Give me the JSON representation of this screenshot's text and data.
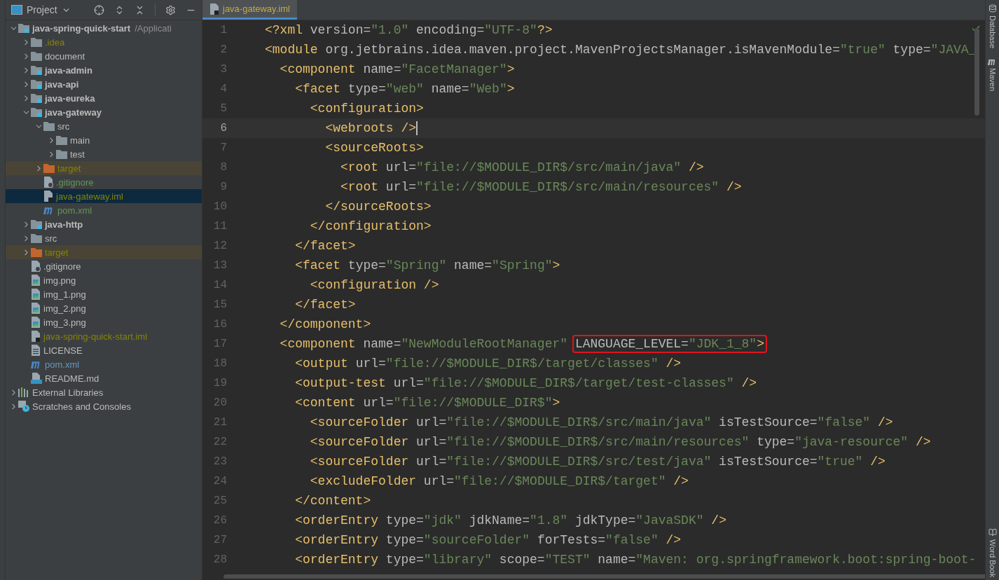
{
  "project_panel": {
    "title": "Project",
    "tree": [
      {
        "name": "java-spring-quick-start",
        "path": "/Applicati",
        "kind": "module",
        "color": "#bbbbbb",
        "expanded": true,
        "selected": false,
        "children": [
          {
            "name": ".idea",
            "kind": "folder",
            "color": "#848504",
            "expanded": false,
            "selected": false
          },
          {
            "name": "document",
            "kind": "folder",
            "color": "#bbbbbb",
            "expanded": false,
            "selected": false
          },
          {
            "name": "java-admin",
            "kind": "module",
            "color": "#bbbbbb",
            "expanded": false,
            "selected": false
          },
          {
            "name": "java-api",
            "kind": "module",
            "color": "#bbbbbb",
            "expanded": false,
            "selected": false
          },
          {
            "name": "java-eureka",
            "kind": "module",
            "color": "#bbbbbb",
            "expanded": false,
            "selected": false
          },
          {
            "name": "java-gateway",
            "kind": "module",
            "color": "#bbbbbb",
            "expanded": true,
            "selected": false,
            "children": [
              {
                "name": "src",
                "kind": "folder",
                "color": "#bbbbbb",
                "expanded": true,
                "selected": false,
                "children": [
                  {
                    "name": "main",
                    "kind": "folder",
                    "color": "#bbbbbb",
                    "expanded": false,
                    "selected": false
                  },
                  {
                    "name": "test",
                    "kind": "folder",
                    "color": "#bbbbbb",
                    "expanded": false,
                    "selected": false
                  }
                ]
              },
              {
                "name": "target",
                "kind": "excluded",
                "color": "#848504",
                "expanded": false,
                "selected": false
              },
              {
                "name": ".gitignore",
                "kind": "ignore-file",
                "color": "#629755",
                "selected": false
              },
              {
                "name": "java-gateway.iml",
                "kind": "iml",
                "color": "#848504",
                "selected": true
              },
              {
                "name": "pom.xml",
                "kind": "maven",
                "color": "#629755",
                "selected": false
              }
            ]
          },
          {
            "name": "java-http",
            "kind": "module",
            "color": "#bbbbbb",
            "expanded": false,
            "selected": false
          },
          {
            "name": "src",
            "kind": "folder",
            "color": "#bbbbbb",
            "expanded": false,
            "selected": false
          },
          {
            "name": "target",
            "kind": "excluded",
            "color": "#848504",
            "expanded": false,
            "selected": false
          },
          {
            "name": ".gitignore",
            "kind": "ignore-file",
            "color": "#bbbbbb",
            "selected": false
          },
          {
            "name": "img.png",
            "kind": "image",
            "color": "#bbbbbb",
            "selected": false
          },
          {
            "name": "img_1.png",
            "kind": "image",
            "color": "#bbbbbb",
            "selected": false
          },
          {
            "name": "img_2.png",
            "kind": "image",
            "color": "#bbbbbb",
            "selected": false
          },
          {
            "name": "img_3.png",
            "kind": "image",
            "color": "#bbbbbb",
            "selected": false
          },
          {
            "name": "java-spring-quick-start.iml",
            "kind": "iml",
            "color": "#848504",
            "selected": false
          },
          {
            "name": "LICENSE",
            "kind": "text",
            "color": "#bbbbbb",
            "selected": false
          },
          {
            "name": "pom.xml",
            "kind": "maven",
            "color": "#6897bb",
            "selected": false
          },
          {
            "name": "README.md",
            "kind": "markdown",
            "color": "#bbbbbb",
            "selected": false
          }
        ]
      },
      {
        "name": "External Libraries",
        "kind": "libraries",
        "color": "#bbbbbb",
        "expanded": false,
        "selected": false
      },
      {
        "name": "Scratches and Consoles",
        "kind": "scratches",
        "color": "#bbbbbb",
        "expanded": false,
        "selected": false
      }
    ]
  },
  "editor": {
    "tabs": [
      {
        "label": "java-gateway.iml",
        "selected": true
      }
    ],
    "lines": [
      {
        "number": "1",
        "current": false,
        "tokens": [
          {
            "kind": "tag",
            "text": "<?xml"
          },
          {
            "kind": "attr",
            "text": " version="
          },
          {
            "kind": "value",
            "text": "\"1.0\""
          },
          {
            "kind": "attr",
            "text": " encoding="
          },
          {
            "kind": "value",
            "text": "\"UTF-8\""
          },
          {
            "kind": "tag",
            "text": "?>"
          }
        ]
      },
      {
        "number": "2",
        "current": false,
        "tokens": [
          {
            "kind": "tag",
            "text": "<module"
          },
          {
            "kind": "attr",
            "text": " org.jetbrains.idea.maven.project.MavenProjectsManager.isMavenModule="
          },
          {
            "kind": "value",
            "text": "\"true\""
          },
          {
            "kind": "attr",
            "text": " type="
          },
          {
            "kind": "value",
            "text": "\"JAVA_"
          }
        ]
      },
      {
        "number": "3",
        "current": false,
        "tokens": [
          {
            "kind": "tag",
            "text": "  <component"
          },
          {
            "kind": "attr",
            "text": " name="
          },
          {
            "kind": "value",
            "text": "\"FacetManager\""
          },
          {
            "kind": "tag",
            "text": ">"
          }
        ]
      },
      {
        "number": "4",
        "current": false,
        "tokens": [
          {
            "kind": "tag",
            "text": "    <facet"
          },
          {
            "kind": "attr",
            "text": " type="
          },
          {
            "kind": "value",
            "text": "\"web\""
          },
          {
            "kind": "attr",
            "text": " name="
          },
          {
            "kind": "value",
            "text": "\"Web\""
          },
          {
            "kind": "tag",
            "text": ">"
          }
        ]
      },
      {
        "number": "5",
        "current": false,
        "tokens": [
          {
            "kind": "tag",
            "text": "      <configuration>"
          }
        ]
      },
      {
        "number": "6",
        "current": true,
        "tokens": [
          {
            "kind": "tag",
            "text": "        <webroots />"
          }
        ]
      },
      {
        "number": "7",
        "current": false,
        "tokens": [
          {
            "kind": "tag",
            "text": "        <sourceRoots>"
          }
        ]
      },
      {
        "number": "8",
        "current": false,
        "tokens": [
          {
            "kind": "tag",
            "text": "          <root"
          },
          {
            "kind": "attr",
            "text": " url="
          },
          {
            "kind": "value",
            "text": "\"file://$MODULE_DIR$/src/main/java\""
          },
          {
            "kind": "tag",
            "text": " />"
          }
        ]
      },
      {
        "number": "9",
        "current": false,
        "tokens": [
          {
            "kind": "tag",
            "text": "          <root"
          },
          {
            "kind": "attr",
            "text": " url="
          },
          {
            "kind": "value",
            "text": "\"file://$MODULE_DIR$/src/main/resources\""
          },
          {
            "kind": "tag",
            "text": " />"
          }
        ]
      },
      {
        "number": "10",
        "current": false,
        "tokens": [
          {
            "kind": "tag",
            "text": "        </sourceRoots>"
          }
        ]
      },
      {
        "number": "11",
        "current": false,
        "tokens": [
          {
            "kind": "tag",
            "text": "      </configuration>"
          }
        ]
      },
      {
        "number": "12",
        "current": false,
        "tokens": [
          {
            "kind": "tag",
            "text": "    </facet>"
          }
        ]
      },
      {
        "number": "13",
        "current": false,
        "tokens": [
          {
            "kind": "tag",
            "text": "    <facet"
          },
          {
            "kind": "attr",
            "text": " type="
          },
          {
            "kind": "value",
            "text": "\"Spring\""
          },
          {
            "kind": "attr",
            "text": " name="
          },
          {
            "kind": "value",
            "text": "\"Spring\""
          },
          {
            "kind": "tag",
            "text": ">"
          }
        ]
      },
      {
        "number": "14",
        "current": false,
        "tokens": [
          {
            "kind": "tag",
            "text": "      <configuration />"
          }
        ]
      },
      {
        "number": "15",
        "current": false,
        "tokens": [
          {
            "kind": "tag",
            "text": "    </facet>"
          }
        ]
      },
      {
        "number": "16",
        "current": false,
        "tokens": [
          {
            "kind": "tag",
            "text": "  </component>"
          }
        ]
      },
      {
        "number": "17",
        "current": false,
        "tokens": [
          {
            "kind": "tag",
            "text": "  <component"
          },
          {
            "kind": "attr",
            "text": " name="
          },
          {
            "kind": "value",
            "text": "\"NewModuleRootManager\" "
          },
          {
            "kind": "attr",
            "text": "LANGUAGE_LEVEL=",
            "marked": true
          },
          {
            "kind": "value",
            "text": "\"JDK_1_8\"",
            "marked": true
          },
          {
            "kind": "tag",
            "text": ">",
            "marked": true
          }
        ]
      },
      {
        "number": "18",
        "current": false,
        "tokens": [
          {
            "kind": "tag",
            "text": "    <output"
          },
          {
            "kind": "attr",
            "text": " url="
          },
          {
            "kind": "value",
            "text": "\"file://$MODULE_DIR$/target/classes\""
          },
          {
            "kind": "tag",
            "text": " />"
          }
        ]
      },
      {
        "number": "19",
        "current": false,
        "tokens": [
          {
            "kind": "tag",
            "text": "    <output-test"
          },
          {
            "kind": "attr",
            "text": " url="
          },
          {
            "kind": "value",
            "text": "\"file://$MODULE_DIR$/target/test-classes\""
          },
          {
            "kind": "tag",
            "text": " />"
          }
        ]
      },
      {
        "number": "20",
        "current": false,
        "tokens": [
          {
            "kind": "tag",
            "text": "    <content"
          },
          {
            "kind": "attr",
            "text": " url="
          },
          {
            "kind": "value",
            "text": "\"file://$MODULE_DIR$\""
          },
          {
            "kind": "tag",
            "text": ">"
          }
        ]
      },
      {
        "number": "21",
        "current": false,
        "tokens": [
          {
            "kind": "tag",
            "text": "      <sourceFolder"
          },
          {
            "kind": "attr",
            "text": " url="
          },
          {
            "kind": "value",
            "text": "\"file://$MODULE_DIR$/src/main/java\""
          },
          {
            "kind": "attr",
            "text": " isTestSource="
          },
          {
            "kind": "value",
            "text": "\"false\""
          },
          {
            "kind": "tag",
            "text": " />"
          }
        ]
      },
      {
        "number": "22",
        "current": false,
        "tokens": [
          {
            "kind": "tag",
            "text": "      <sourceFolder"
          },
          {
            "kind": "attr",
            "text": " url="
          },
          {
            "kind": "value",
            "text": "\"file://$MODULE_DIR$/src/main/resources\""
          },
          {
            "kind": "attr",
            "text": " type="
          },
          {
            "kind": "value",
            "text": "\"java-resource\""
          },
          {
            "kind": "tag",
            "text": " />"
          }
        ]
      },
      {
        "number": "23",
        "current": false,
        "tokens": [
          {
            "kind": "tag",
            "text": "      <sourceFolder"
          },
          {
            "kind": "attr",
            "text": " url="
          },
          {
            "kind": "value",
            "text": "\"file://$MODULE_DIR$/src/test/java\""
          },
          {
            "kind": "attr",
            "text": " isTestSource="
          },
          {
            "kind": "value",
            "text": "\"true\""
          },
          {
            "kind": "tag",
            "text": " />"
          }
        ]
      },
      {
        "number": "24",
        "current": false,
        "tokens": [
          {
            "kind": "tag",
            "text": "      <excludeFolder"
          },
          {
            "kind": "attr",
            "text": " url="
          },
          {
            "kind": "value",
            "text": "\"file://$MODULE_DIR$/target\""
          },
          {
            "kind": "tag",
            "text": " />"
          }
        ]
      },
      {
        "number": "25",
        "current": false,
        "tokens": [
          {
            "kind": "tag",
            "text": "    </content>"
          }
        ]
      },
      {
        "number": "26",
        "current": false,
        "tokens": [
          {
            "kind": "tag",
            "text": "    <orderEntry"
          },
          {
            "kind": "attr",
            "text": " type="
          },
          {
            "kind": "value",
            "text": "\"jdk\""
          },
          {
            "kind": "attr",
            "text": " jdkName="
          },
          {
            "kind": "value",
            "text": "\"1.8\""
          },
          {
            "kind": "attr",
            "text": " jdkType="
          },
          {
            "kind": "value",
            "text": "\"JavaSDK\""
          },
          {
            "kind": "tag",
            "text": " />"
          }
        ]
      },
      {
        "number": "27",
        "current": false,
        "tokens": [
          {
            "kind": "tag",
            "text": "    <orderEntry"
          },
          {
            "kind": "attr",
            "text": " type="
          },
          {
            "kind": "value",
            "text": "\"sourceFolder\""
          },
          {
            "kind": "attr",
            "text": " forTests="
          },
          {
            "kind": "value",
            "text": "\"false\""
          },
          {
            "kind": "tag",
            "text": " />"
          }
        ]
      },
      {
        "number": "28",
        "current": false,
        "tokens": [
          {
            "kind": "tag",
            "text": "    <orderEntry"
          },
          {
            "kind": "attr",
            "text": " type="
          },
          {
            "kind": "value",
            "text": "\"library\""
          },
          {
            "kind": "attr",
            "text": " scope="
          },
          {
            "kind": "value",
            "text": "\"TEST\""
          },
          {
            "kind": "attr",
            "text": " name="
          },
          {
            "kind": "value",
            "text": "\"Maven: org.springframework.boot:spring-boot-"
          }
        ]
      }
    ]
  },
  "right_tool_windows": {
    "top": [
      {
        "label": "Database",
        "kind": "database"
      },
      {
        "label": "Maven",
        "kind": "maven"
      }
    ],
    "bottom": [
      {
        "label": "Word Book",
        "kind": "book"
      }
    ]
  }
}
